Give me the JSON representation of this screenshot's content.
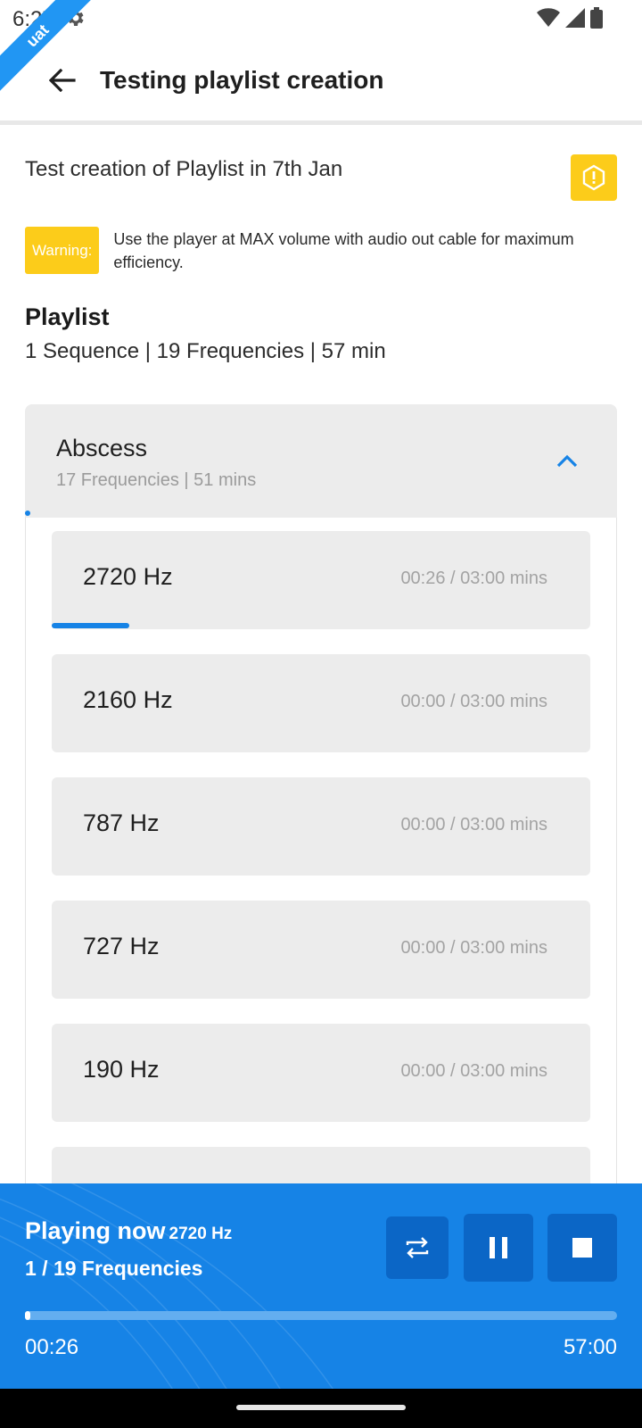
{
  "status": {
    "time": "6:27",
    "ribbon": "uat"
  },
  "app_bar": {
    "title": "Testing playlist creation"
  },
  "description": "Test creation of Playlist in 7th Jan",
  "warning": {
    "label": "Warning:",
    "text": "Use the player at MAX volume with audio out cable for maximum efficiency."
  },
  "playlist": {
    "heading": "Playlist",
    "summary": "1 Sequence | 19 Frequencies | 57 min"
  },
  "sequence": {
    "name": "Abscess",
    "meta": "17 Frequencies | 51 mins",
    "expanded": true,
    "items": [
      {
        "hz": "2720 Hz",
        "time": "00:26 / 03:00 mins",
        "progress": 0.144
      },
      {
        "hz": "2160 Hz",
        "time": "00:00 / 03:00 mins",
        "progress": 0
      },
      {
        "hz": "787 Hz",
        "time": "00:00 / 03:00 mins",
        "progress": 0
      },
      {
        "hz": "727 Hz",
        "time": "00:00 / 03:00 mins",
        "progress": 0
      },
      {
        "hz": "190 Hz",
        "time": "00:00 / 03:00 mins",
        "progress": 0
      }
    ]
  },
  "player": {
    "playing_label": "Playing now",
    "current_hz": "2720 Hz",
    "count": "1 / 19  Frequencies",
    "elapsed": "00:26",
    "total": "57:00",
    "progress": 0.0076
  },
  "colors": {
    "accent": "#1683e6",
    "warning": "#fccc1a",
    "card": "#ececec"
  }
}
